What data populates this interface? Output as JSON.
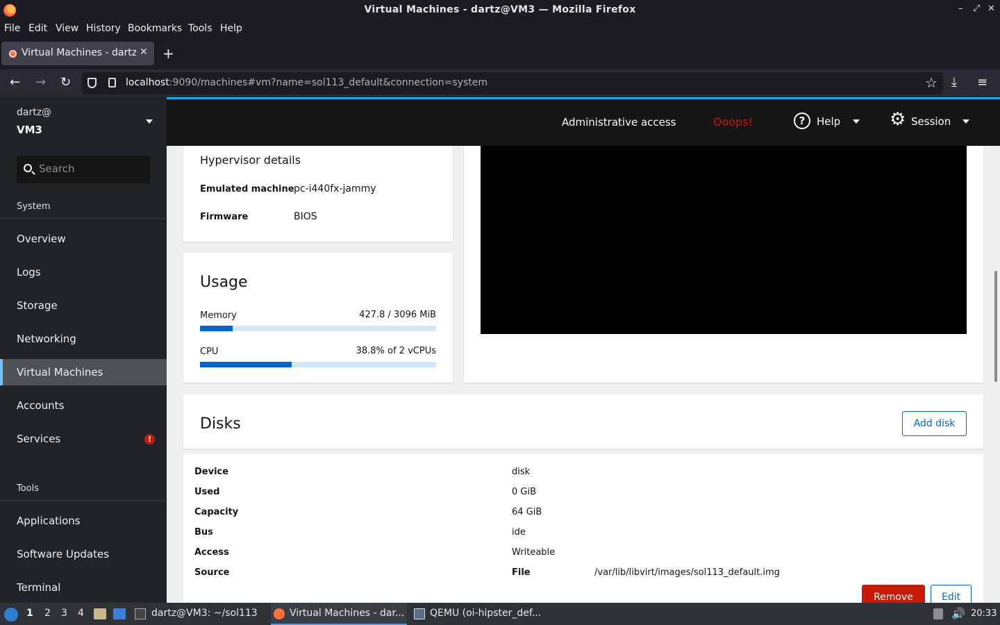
{
  "window": {
    "title": "Virtual Machines - dartz@VM3 — Mozilla Firefox"
  },
  "menu": [
    "File",
    "Edit",
    "View",
    "History",
    "Bookmarks",
    "Tools",
    "Help"
  ],
  "tab": {
    "label": "Virtual Machines - dartz@"
  },
  "urlbar": {
    "host": "localhost",
    "rest": ":9090/machines#vm?name=sol113_default&connection=system"
  },
  "host_selector": {
    "user": "dartz@",
    "host": "VM3"
  },
  "search": {
    "placeholder": "Search"
  },
  "sidebar": {
    "system_heading": "System",
    "system_items": [
      "Overview",
      "Logs",
      "Storage",
      "Networking",
      "Virtual Machines",
      "Accounts",
      "Services"
    ],
    "active_item": "Virtual Machines",
    "tools_heading": "Tools",
    "tools_items": [
      "Applications",
      "Software Updates",
      "Terminal"
    ]
  },
  "topbar": {
    "admin": "Administrative access",
    "oops": "Ooops!",
    "help": "Help",
    "session": "Session"
  },
  "hypervisor": {
    "title": "Hypervisor details",
    "emulated_label": "Emulated machine",
    "emulated_value": "pc-i440fx-jammy",
    "firmware_label": "Firmware",
    "firmware_value": "BIOS"
  },
  "usage": {
    "title": "Usage",
    "memory_label": "Memory",
    "memory_value": "427.8 / 3096 MiB",
    "memory_fraction": 0.138,
    "cpu_label": "CPU",
    "cpu_value": "38.8% of 2 vCPUs",
    "cpu_fraction": 0.388
  },
  "disks": {
    "title": "Disks",
    "add_label": "Add disk",
    "rows": [
      {
        "term": "Device",
        "value": "disk"
      },
      {
        "term": "Used",
        "value": "0 GiB"
      },
      {
        "term": "Capacity",
        "value": "64 GiB"
      },
      {
        "term": "Bus",
        "value": "ide"
      },
      {
        "term": "Access",
        "value": "Writeable"
      },
      {
        "term": "Source",
        "value": "File"
      }
    ],
    "source_path": "/var/lib/libvirt/images/sol113_default.img",
    "remove_label": "Remove",
    "edit_label": "Edit"
  },
  "taskbar": {
    "workspaces": [
      "1",
      "2",
      "3",
      "4"
    ],
    "tasks": [
      "dartz@VM3: ~/sol113",
      "Virtual Machines - dar...",
      "QEMU (oi-hipster_def..."
    ],
    "clock": "20:33"
  },
  "colors": {
    "accent": "#0066cc",
    "danger": "#c9190b",
    "sidebar_bg": "#212427"
  }
}
